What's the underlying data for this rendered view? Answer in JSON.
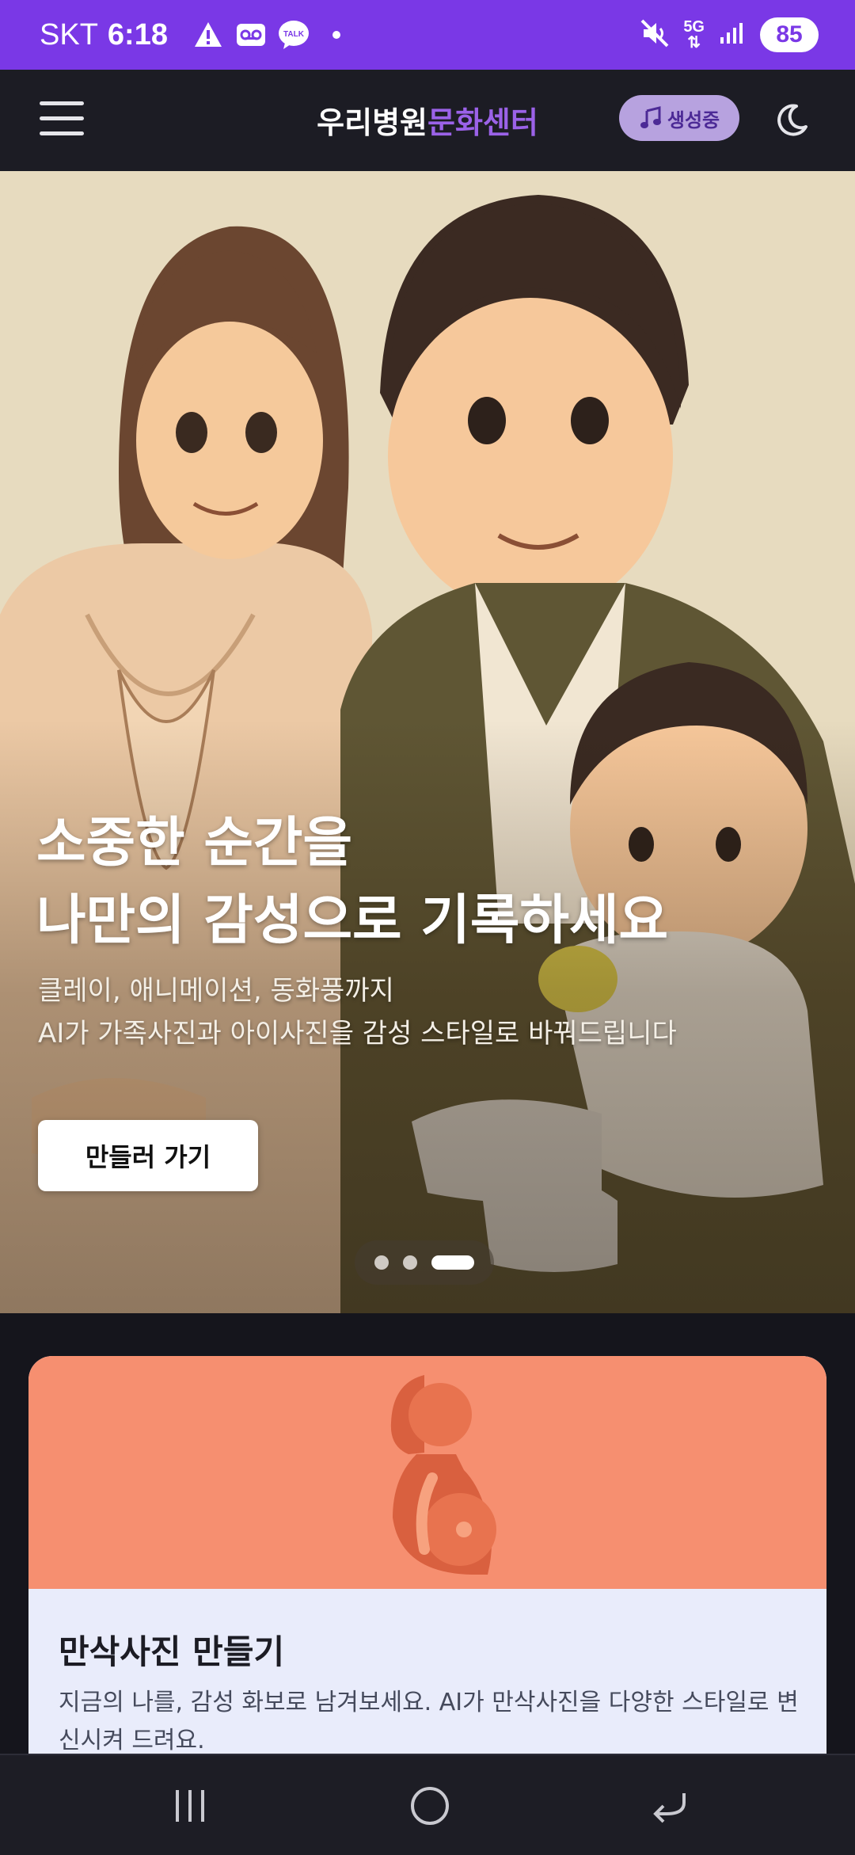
{
  "status_bar": {
    "carrier": "SKT",
    "time": "6:18",
    "network": "5G",
    "battery": "85",
    "icons": [
      "alert-icon",
      "voicemail-icon",
      "talk-icon",
      "dot-icon",
      "mute-icon",
      "data-arrows-icon",
      "signal-icon"
    ],
    "talk_label": "TALK"
  },
  "header": {
    "brand_part1": "우리병원",
    "brand_part2": "문화센터",
    "generating_label": "생성중",
    "accent": "#9b62e8"
  },
  "hero": {
    "title_line1": "소중한 순간을",
    "title_line2": "나만의 감성으로 기록하세요",
    "subtitle_line1": "클레이, 애니메이션, 동화풍까지",
    "subtitle_line2": "AI가 가족사진과 아이사진을 감성 스타일로 바꿔드립니다",
    "cta_label": "만들러 가기",
    "slides_total": 3,
    "slide_active": 3
  },
  "card": {
    "title": "만삭사진 만들기",
    "description": "지금의 나를, 감성 화보로 남겨보세요. AI가 만삭사진을 다양한 스타일로 변신시켜 드려요.",
    "banner_color": "#f68f70"
  },
  "colors": {
    "status_bar": "#7a38e6",
    "app_bar": "#1c1c24",
    "background": "#15151c"
  }
}
